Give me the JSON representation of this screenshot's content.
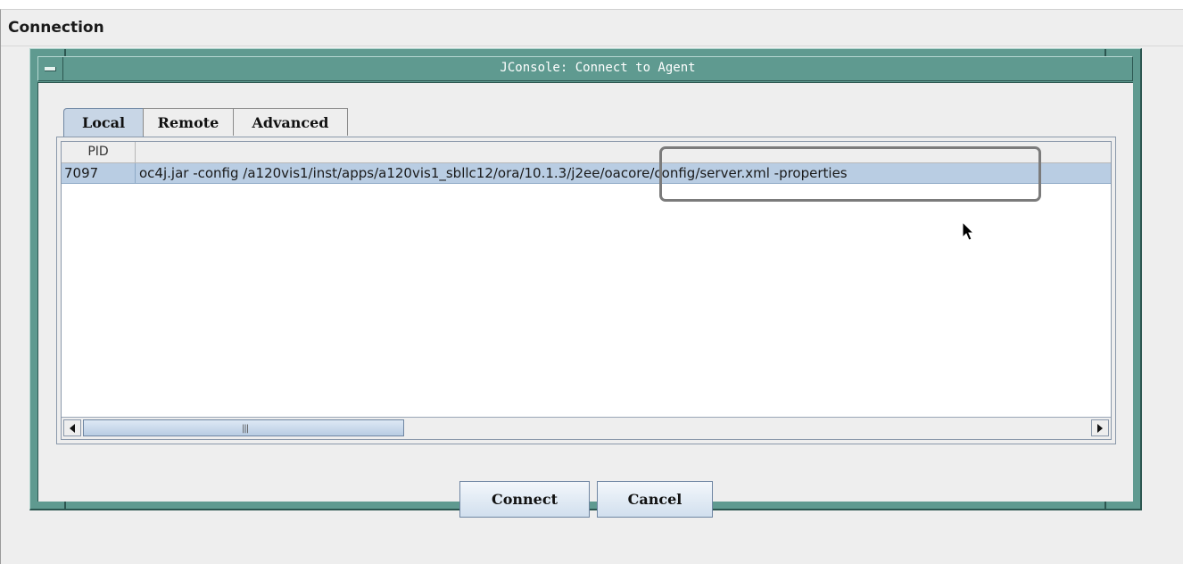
{
  "outer_window": {
    "title": "Connection"
  },
  "dialog": {
    "title": "JConsole: Connect to Agent",
    "tabs": [
      {
        "label": "Local",
        "selected": true
      },
      {
        "label": "Remote",
        "selected": false
      },
      {
        "label": "Advanced",
        "selected": false
      }
    ],
    "table": {
      "columns": [
        "PID",
        ""
      ],
      "rows": [
        {
          "pid": "7097",
          "command": "oc4j.jar -config /a120vis1/inst/apps/a120vis1_sbllc12/ora/10.1.3/j2ee/oacore/config/server.xml -properties"
        }
      ]
    },
    "buttons": {
      "connect": "Connect",
      "cancel": "Cancel"
    }
  },
  "colors": {
    "frame": "#5f9a90",
    "selection": "#b9cde3",
    "annotation_box": "#7b7b7b"
  }
}
